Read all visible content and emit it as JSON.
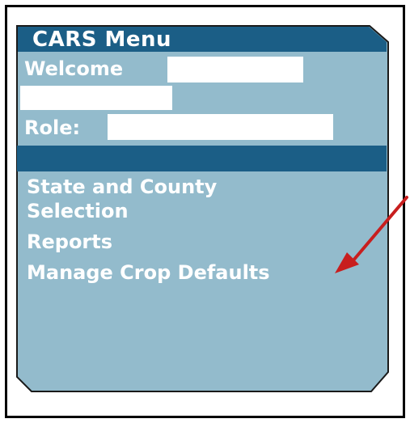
{
  "menu": {
    "title": "CARS Menu",
    "welcome_label": "Welcome",
    "role_label": "Role:",
    "links": [
      {
        "line1": "State and County",
        "line2": "Selection"
      },
      {
        "line1": "Reports"
      },
      {
        "line1": "Manage Crop Defaults"
      }
    ]
  },
  "colors": {
    "header": "#1b5e86",
    "panel": "#93bbcc",
    "arrow": "#c81e1e"
  },
  "annotation": {
    "icon": "red-arrow-icon",
    "points_to": "Manage Crop Defaults"
  }
}
